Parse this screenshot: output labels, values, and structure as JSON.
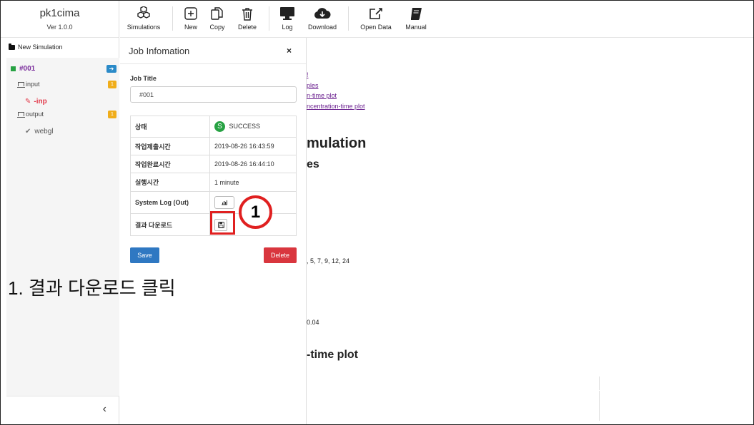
{
  "app": {
    "title": "pk1cima",
    "version": "Ver 1.0.0"
  },
  "sidebar": {
    "new_simulation": "New Simulation",
    "job": {
      "label": "#001",
      "arrow": "➔"
    },
    "input": {
      "label": "input",
      "count": "1"
    },
    "input_file": {
      "label": "-inp"
    },
    "output": {
      "label": "output",
      "count": "1"
    },
    "output_file": {
      "label": "webgl"
    },
    "collapse": "‹"
  },
  "toolbar": {
    "simulations": "Simulations",
    "new": "New",
    "copy": "Copy",
    "delete": "Delete",
    "log": "Log",
    "download": "Download",
    "open_data": "Open Data",
    "manual": "Manual"
  },
  "modal": {
    "title": "Job Infomation",
    "close": "×",
    "job_title_label": "Job Title",
    "job_title_value": "#001",
    "rows": [
      {
        "key": "상태",
        "value": "SUCCESS",
        "status_letter": "S"
      },
      {
        "key": "작업제출시간",
        "value": "2019-08-26 16:43:59"
      },
      {
        "key": "작업완료시간",
        "value": "2019-08-26 16:44:10"
      },
      {
        "key": "실행시간",
        "value": "1 minute"
      },
      {
        "key": "System Log (Out)"
      },
      {
        "key": "결과 다운로드"
      }
    ],
    "save": "Save",
    "delete": "Delete"
  },
  "background": {
    "links": [
      "!",
      "ples",
      "n-time plot",
      "ncentration-time plot"
    ],
    "heading1": "mulation",
    "heading2": "es",
    "text1": ", 5, 7, 9, 12, 24",
    "text2": "0.04",
    "heading3": "-time plot"
  },
  "annotation": {
    "step_number": "1",
    "instruction": "1. 결과 다운로드 클릭"
  },
  "colors": {
    "accent_blue": "#2f78c2",
    "danger_red": "#d9363e",
    "success_green": "#27a243",
    "highlight_red": "#e02020",
    "job_purple": "#7a2d9c"
  }
}
